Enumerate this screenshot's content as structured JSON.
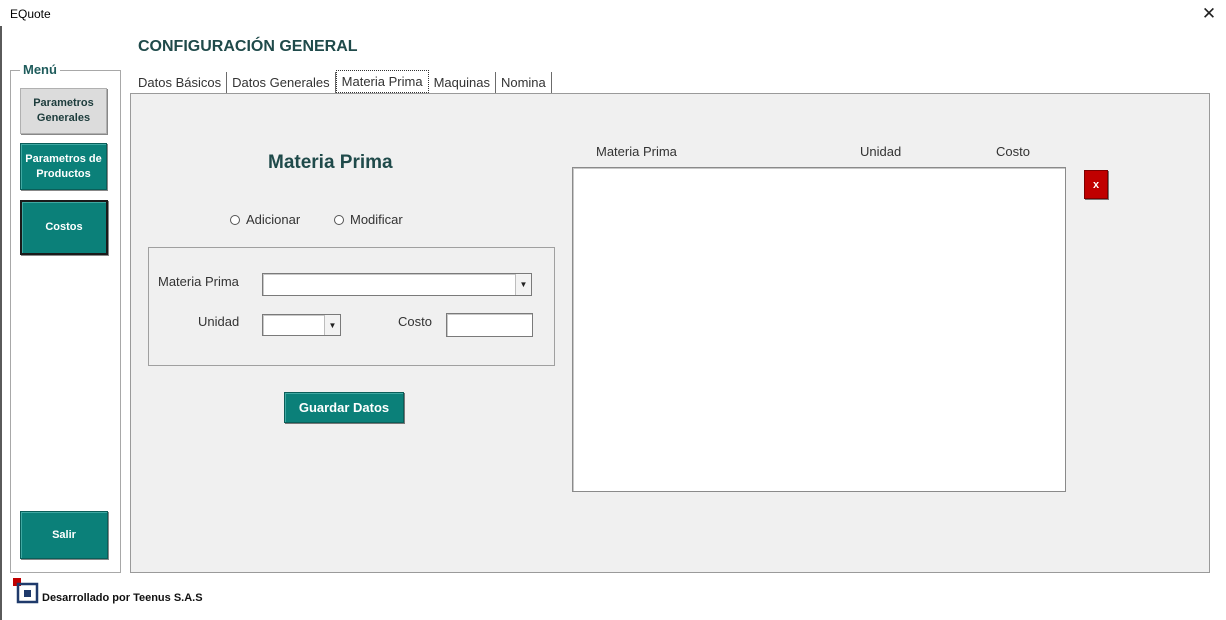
{
  "window": {
    "title": "EQuote",
    "close_glyph": "✕"
  },
  "menu": {
    "legend": "Menú",
    "buttons": [
      {
        "label_line1": "Parametros",
        "label_line2": "Generales"
      },
      {
        "label_line1": "Parametros de",
        "label_line2": "Productos"
      },
      {
        "label": "Costos"
      },
      {
        "label": "Salir"
      }
    ]
  },
  "page": {
    "heading": "CONFIGURACIÓN GENERAL"
  },
  "tabs": [
    "Datos Básicos",
    "Datos Generales",
    "Materia Prima",
    "Maquinas",
    "Nomina"
  ],
  "active_tab": "Materia Prima",
  "form": {
    "section_title": "Materia Prima",
    "radio_add": "Adicionar",
    "radio_modify": "Modificar",
    "materia_label": "Materia Prima",
    "materia_value": "",
    "unidad_label": "Unidad",
    "unidad_value": "",
    "costo_label": "Costo",
    "costo_value": "",
    "save_label": "Guardar Datos"
  },
  "list": {
    "columns": [
      "Materia Prima",
      "Unidad",
      "Costo"
    ],
    "rows": [],
    "delete_label": "x"
  },
  "footer": {
    "text": "Desarrollado por Teenus S.A.S"
  },
  "colors": {
    "accent": "#0b8079",
    "danger": "#c00000",
    "heading": "#1f4a4a"
  },
  "icons": {
    "close": "close-icon",
    "dropdown": "chevron-down-icon",
    "logo": "teenus-logo-icon"
  }
}
